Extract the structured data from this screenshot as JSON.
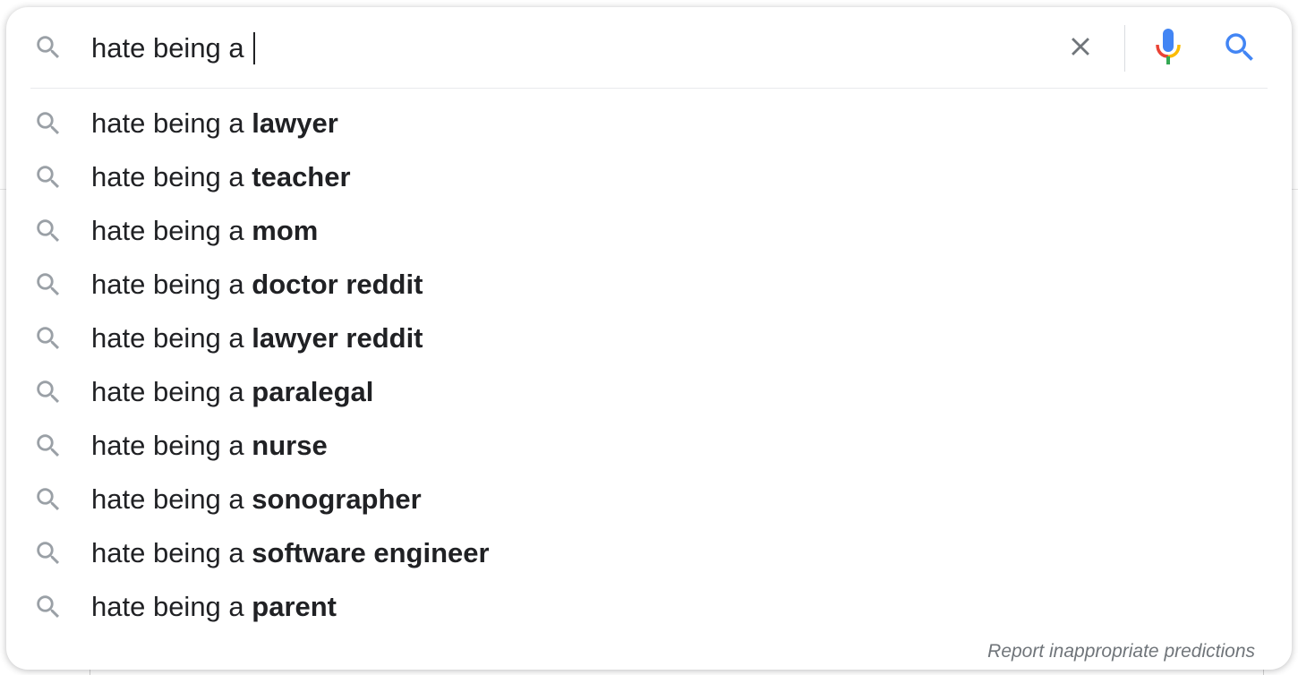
{
  "search": {
    "query": "hate being a "
  },
  "icons": {
    "search": "search-icon",
    "clear": "close-icon",
    "voice": "microphone-icon",
    "submit": "search-icon"
  },
  "colors": {
    "icon_gray": "#9aa0a6",
    "clear_gray": "#70757a",
    "submit_blue": "#4285f4",
    "mic_blue": "#4285f4",
    "mic_red": "#ea4335",
    "mic_yellow": "#fbbc04",
    "mic_green": "#34a853",
    "text": "#202124"
  },
  "suggestions": [
    {
      "prefix": "hate being a ",
      "completion": "lawyer"
    },
    {
      "prefix": "hate being a ",
      "completion": "teacher"
    },
    {
      "prefix": "hate being a ",
      "completion": "mom"
    },
    {
      "prefix": "hate being a ",
      "completion": "doctor reddit"
    },
    {
      "prefix": "hate being a ",
      "completion": "lawyer reddit"
    },
    {
      "prefix": "hate being a ",
      "completion": "paralegal"
    },
    {
      "prefix": "hate being a ",
      "completion": "nurse"
    },
    {
      "prefix": "hate being a ",
      "completion": "sonographer"
    },
    {
      "prefix": "hate being a ",
      "completion": "software engineer"
    },
    {
      "prefix": "hate being a ",
      "completion": "parent"
    }
  ],
  "footer": {
    "report_label": "Report inappropriate predictions"
  }
}
